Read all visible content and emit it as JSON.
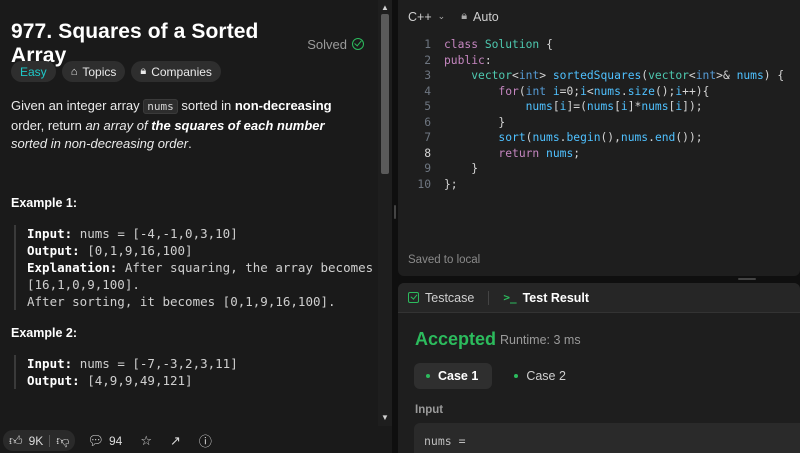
{
  "problem": {
    "title": "977. Squares of a Sorted Array",
    "status": "Solved",
    "tags": {
      "difficulty": "Easy",
      "topics": "Topics",
      "companies": "Companies"
    },
    "description": {
      "p1": "Given an integer array ",
      "code": "nums",
      "p2": " sorted in ",
      "b1": "non-decreasing",
      "p3": " order, return ",
      "i1": "an array of ",
      "bi": "the squares of each number",
      "i2": " sorted in non-decreasing order",
      "p4": "."
    },
    "examples": [
      {
        "title": "Example 1:",
        "input_label": "Input:",
        "input": "nums = [-4,-1,0,3,10]",
        "output_label": "Output:",
        "output": "[0,1,9,16,100]",
        "explanation_label": "Explanation:",
        "explanation_1": "After squaring, the array becomes",
        "explanation_2": "[16,1,0,9,100].",
        "explanation_3": "After sorting, it becomes [0,1,9,16,100]."
      },
      {
        "title": "Example 2:",
        "input_label": "Input:",
        "input": "nums = [-7,-3,2,3,11]",
        "output_label": "Output:",
        "output": "[4,9,9,49,121]"
      }
    ]
  },
  "bottom_bar": {
    "likes": "9K",
    "comments": "94"
  },
  "editor": {
    "language": "C++",
    "mode": "Auto",
    "saved": "Saved to local",
    "current_line": 8,
    "lines": [
      "class Solution {",
      "public:",
      "    vector<int> sortedSquares(vector<int>& nums) {",
      "        for(int i=0;i<nums.size();i++){",
      "            nums[i]=(nums[i]*nums[i]);",
      "        }",
      "        sort(nums.begin(),nums.end());",
      "        return nums;",
      "    }",
      "};"
    ]
  },
  "results": {
    "tab_testcase": "Testcase",
    "tab_result": "Test Result",
    "verdict": "Accepted",
    "runtime": "Runtime: 3 ms",
    "cases": [
      "Case 1",
      "Case 2"
    ],
    "input_label": "Input",
    "input_value": "nums ="
  },
  "colors": {
    "accent_green": "#2cbb5d",
    "easy": "#1ec8c8"
  }
}
